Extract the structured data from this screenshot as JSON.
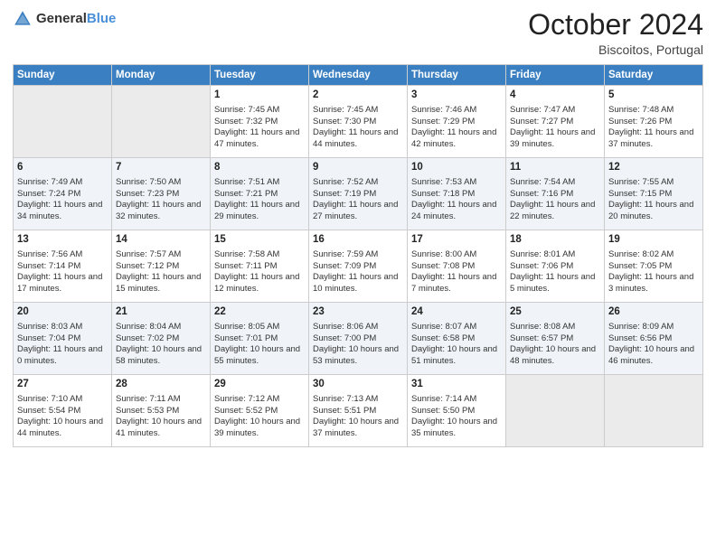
{
  "header": {
    "logo_general": "General",
    "logo_blue": "Blue",
    "month": "October 2024",
    "location": "Biscoitos, Portugal"
  },
  "days_of_week": [
    "Sunday",
    "Monday",
    "Tuesday",
    "Wednesday",
    "Thursday",
    "Friday",
    "Saturday"
  ],
  "weeks": [
    [
      {
        "day": "",
        "info": ""
      },
      {
        "day": "",
        "info": ""
      },
      {
        "day": "1",
        "info": "Sunrise: 7:45 AM\nSunset: 7:32 PM\nDaylight: 11 hours and 47 minutes."
      },
      {
        "day": "2",
        "info": "Sunrise: 7:45 AM\nSunset: 7:30 PM\nDaylight: 11 hours and 44 minutes."
      },
      {
        "day": "3",
        "info": "Sunrise: 7:46 AM\nSunset: 7:29 PM\nDaylight: 11 hours and 42 minutes."
      },
      {
        "day": "4",
        "info": "Sunrise: 7:47 AM\nSunset: 7:27 PM\nDaylight: 11 hours and 39 minutes."
      },
      {
        "day": "5",
        "info": "Sunrise: 7:48 AM\nSunset: 7:26 PM\nDaylight: 11 hours and 37 minutes."
      }
    ],
    [
      {
        "day": "6",
        "info": "Sunrise: 7:49 AM\nSunset: 7:24 PM\nDaylight: 11 hours and 34 minutes."
      },
      {
        "day": "7",
        "info": "Sunrise: 7:50 AM\nSunset: 7:23 PM\nDaylight: 11 hours and 32 minutes."
      },
      {
        "day": "8",
        "info": "Sunrise: 7:51 AM\nSunset: 7:21 PM\nDaylight: 11 hours and 29 minutes."
      },
      {
        "day": "9",
        "info": "Sunrise: 7:52 AM\nSunset: 7:19 PM\nDaylight: 11 hours and 27 minutes."
      },
      {
        "day": "10",
        "info": "Sunrise: 7:53 AM\nSunset: 7:18 PM\nDaylight: 11 hours and 24 minutes."
      },
      {
        "day": "11",
        "info": "Sunrise: 7:54 AM\nSunset: 7:16 PM\nDaylight: 11 hours and 22 minutes."
      },
      {
        "day": "12",
        "info": "Sunrise: 7:55 AM\nSunset: 7:15 PM\nDaylight: 11 hours and 20 minutes."
      }
    ],
    [
      {
        "day": "13",
        "info": "Sunrise: 7:56 AM\nSunset: 7:14 PM\nDaylight: 11 hours and 17 minutes."
      },
      {
        "day": "14",
        "info": "Sunrise: 7:57 AM\nSunset: 7:12 PM\nDaylight: 11 hours and 15 minutes."
      },
      {
        "day": "15",
        "info": "Sunrise: 7:58 AM\nSunset: 7:11 PM\nDaylight: 11 hours and 12 minutes."
      },
      {
        "day": "16",
        "info": "Sunrise: 7:59 AM\nSunset: 7:09 PM\nDaylight: 11 hours and 10 minutes."
      },
      {
        "day": "17",
        "info": "Sunrise: 8:00 AM\nSunset: 7:08 PM\nDaylight: 11 hours and 7 minutes."
      },
      {
        "day": "18",
        "info": "Sunrise: 8:01 AM\nSunset: 7:06 PM\nDaylight: 11 hours and 5 minutes."
      },
      {
        "day": "19",
        "info": "Sunrise: 8:02 AM\nSunset: 7:05 PM\nDaylight: 11 hours and 3 minutes."
      }
    ],
    [
      {
        "day": "20",
        "info": "Sunrise: 8:03 AM\nSunset: 7:04 PM\nDaylight: 11 hours and 0 minutes."
      },
      {
        "day": "21",
        "info": "Sunrise: 8:04 AM\nSunset: 7:02 PM\nDaylight: 10 hours and 58 minutes."
      },
      {
        "day": "22",
        "info": "Sunrise: 8:05 AM\nSunset: 7:01 PM\nDaylight: 10 hours and 55 minutes."
      },
      {
        "day": "23",
        "info": "Sunrise: 8:06 AM\nSunset: 7:00 PM\nDaylight: 10 hours and 53 minutes."
      },
      {
        "day": "24",
        "info": "Sunrise: 8:07 AM\nSunset: 6:58 PM\nDaylight: 10 hours and 51 minutes."
      },
      {
        "day": "25",
        "info": "Sunrise: 8:08 AM\nSunset: 6:57 PM\nDaylight: 10 hours and 48 minutes."
      },
      {
        "day": "26",
        "info": "Sunrise: 8:09 AM\nSunset: 6:56 PM\nDaylight: 10 hours and 46 minutes."
      }
    ],
    [
      {
        "day": "27",
        "info": "Sunrise: 7:10 AM\nSunset: 5:54 PM\nDaylight: 10 hours and 44 minutes."
      },
      {
        "day": "28",
        "info": "Sunrise: 7:11 AM\nSunset: 5:53 PM\nDaylight: 10 hours and 41 minutes."
      },
      {
        "day": "29",
        "info": "Sunrise: 7:12 AM\nSunset: 5:52 PM\nDaylight: 10 hours and 39 minutes."
      },
      {
        "day": "30",
        "info": "Sunrise: 7:13 AM\nSunset: 5:51 PM\nDaylight: 10 hours and 37 minutes."
      },
      {
        "day": "31",
        "info": "Sunrise: 7:14 AM\nSunset: 5:50 PM\nDaylight: 10 hours and 35 minutes."
      },
      {
        "day": "",
        "info": ""
      },
      {
        "day": "",
        "info": ""
      }
    ]
  ]
}
